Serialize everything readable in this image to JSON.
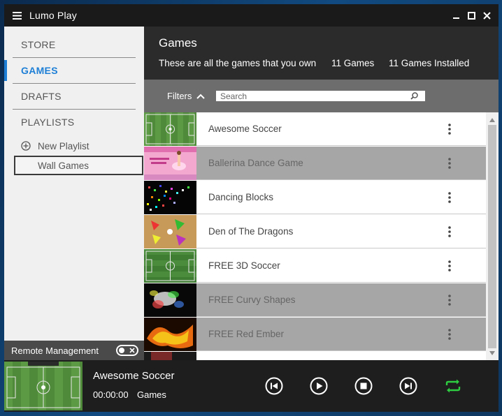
{
  "window": {
    "app_title": "Lumo Play",
    "controls": [
      "minimize",
      "maximize",
      "close"
    ]
  },
  "sidebar": {
    "nav": [
      {
        "label": "STORE",
        "active": false
      },
      {
        "label": "GAMES",
        "active": true
      },
      {
        "label": "DRAFTS",
        "active": false
      },
      {
        "label": "PLAYLISTS",
        "active": false
      }
    ],
    "new_playlist_label": "New Playlist",
    "playlists": [
      "Wall Games"
    ],
    "remote_management_label": "Remote Management",
    "remote_management_on": false
  },
  "header": {
    "title": "Games",
    "description": "These are all the games that you own",
    "games_count": "11 Games",
    "installed_count": "11 Games Installed"
  },
  "filters": {
    "label": "Filters",
    "search_placeholder": "Search"
  },
  "games": [
    {
      "name": "Awesome Soccer",
      "installed_highlight": false,
      "thumb": "soccer"
    },
    {
      "name": "Ballerina Dance Game",
      "installed_highlight": true,
      "thumb": "ballerina"
    },
    {
      "name": "Dancing Blocks",
      "installed_highlight": false,
      "thumb": "blocks"
    },
    {
      "name": "Den of The Dragons",
      "installed_highlight": false,
      "thumb": "dragons"
    },
    {
      "name": "FREE 3D Soccer",
      "installed_highlight": false,
      "thumb": "soccer"
    },
    {
      "name": "FREE Curvy Shapes",
      "installed_highlight": true,
      "thumb": "shapes"
    },
    {
      "name": "FREE Red Ember",
      "installed_highlight": true,
      "thumb": "ember"
    }
  ],
  "player": {
    "now_playing_title": "Awesome Soccer",
    "time": "00:00:00",
    "source": "Games",
    "buttons": [
      "previous-icon",
      "play-icon",
      "stop-icon",
      "next-icon",
      "repeat-icon"
    ],
    "repeat_color": "#2ecc40"
  },
  "colors": {
    "accent": "#1e7fd6",
    "dark_bg": "#2b2b2b",
    "filter_bg": "#6d6d6d",
    "dim_row": "#a6a6a6"
  }
}
